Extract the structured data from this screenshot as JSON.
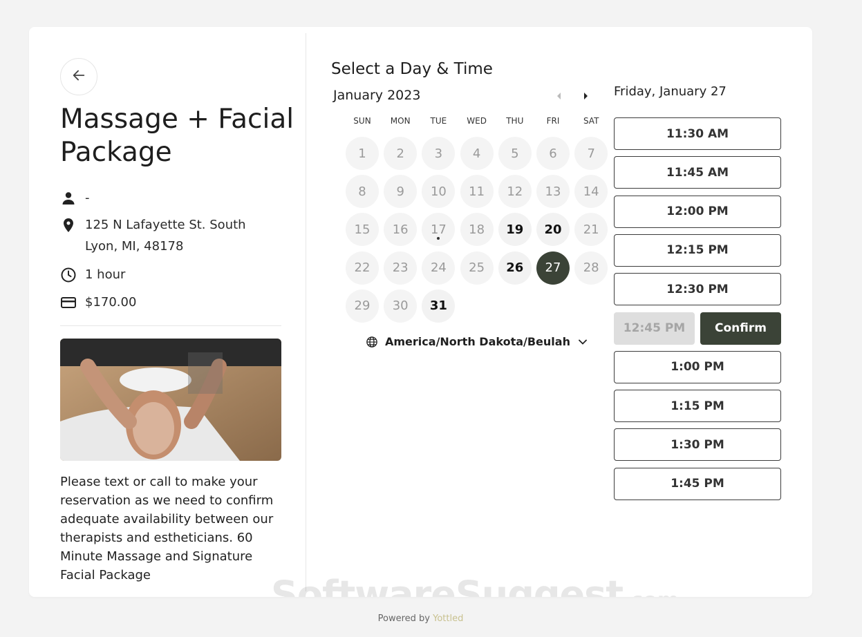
{
  "event": {
    "title": "Massage + Facial Package",
    "host": "-",
    "location": "125 N Lafayette St. South Lyon, MI, 48178",
    "duration": "1 hour",
    "price": "$170.00",
    "description": "Please text or call to make your reservation as we need to confirm adequate availability between our therapists and estheticians. 60 Minute Massage and Signature Facial Package"
  },
  "calendar": {
    "heading": "Select a Day & Time",
    "month_label": "January 2023",
    "weekdays": [
      "SUN",
      "MON",
      "TUE",
      "WED",
      "THU",
      "FRI",
      "SAT"
    ],
    "days": [
      {
        "label": "1",
        "state": "disabled"
      },
      {
        "label": "2",
        "state": "disabled"
      },
      {
        "label": "3",
        "state": "disabled"
      },
      {
        "label": "4",
        "state": "disabled"
      },
      {
        "label": "5",
        "state": "disabled"
      },
      {
        "label": "6",
        "state": "disabled"
      },
      {
        "label": "7",
        "state": "disabled"
      },
      {
        "label": "8",
        "state": "disabled"
      },
      {
        "label": "9",
        "state": "disabled"
      },
      {
        "label": "10",
        "state": "disabled"
      },
      {
        "label": "11",
        "state": "disabled"
      },
      {
        "label": "12",
        "state": "disabled"
      },
      {
        "label": "13",
        "state": "disabled"
      },
      {
        "label": "14",
        "state": "disabled"
      },
      {
        "label": "15",
        "state": "disabled"
      },
      {
        "label": "16",
        "state": "disabled"
      },
      {
        "label": "17",
        "state": "disabled",
        "today": true
      },
      {
        "label": "18",
        "state": "disabled"
      },
      {
        "label": "19",
        "state": "available"
      },
      {
        "label": "20",
        "state": "available"
      },
      {
        "label": "21",
        "state": "disabled"
      },
      {
        "label": "22",
        "state": "disabled"
      },
      {
        "label": "23",
        "state": "disabled"
      },
      {
        "label": "24",
        "state": "disabled"
      },
      {
        "label": "25",
        "state": "disabled"
      },
      {
        "label": "26",
        "state": "available"
      },
      {
        "label": "27",
        "state": "selected"
      },
      {
        "label": "28",
        "state": "disabled"
      },
      {
        "label": "29",
        "state": "disabled"
      },
      {
        "label": "30",
        "state": "disabled"
      },
      {
        "label": "31",
        "state": "available"
      }
    ],
    "timezone": "America/North Dakota/Beulah"
  },
  "times": {
    "date_label": "Friday, January 27",
    "slots": [
      "11:30 AM",
      "11:45 AM",
      "12:00 PM",
      "12:15 PM",
      "12:30 PM",
      "12:45 PM",
      "1:00 PM",
      "1:15 PM",
      "1:30 PM",
      "1:45 PM"
    ],
    "active_slot": "12:45 PM",
    "confirm_label": "Confirm"
  },
  "watermark": {
    "main": "SoftwareSuggest",
    "suffix": ".com"
  },
  "footer": {
    "prefix": "Powered by ",
    "brand": "Yottled"
  },
  "colors": {
    "accent": "#3b4337",
    "brand": "#c8c18f"
  }
}
